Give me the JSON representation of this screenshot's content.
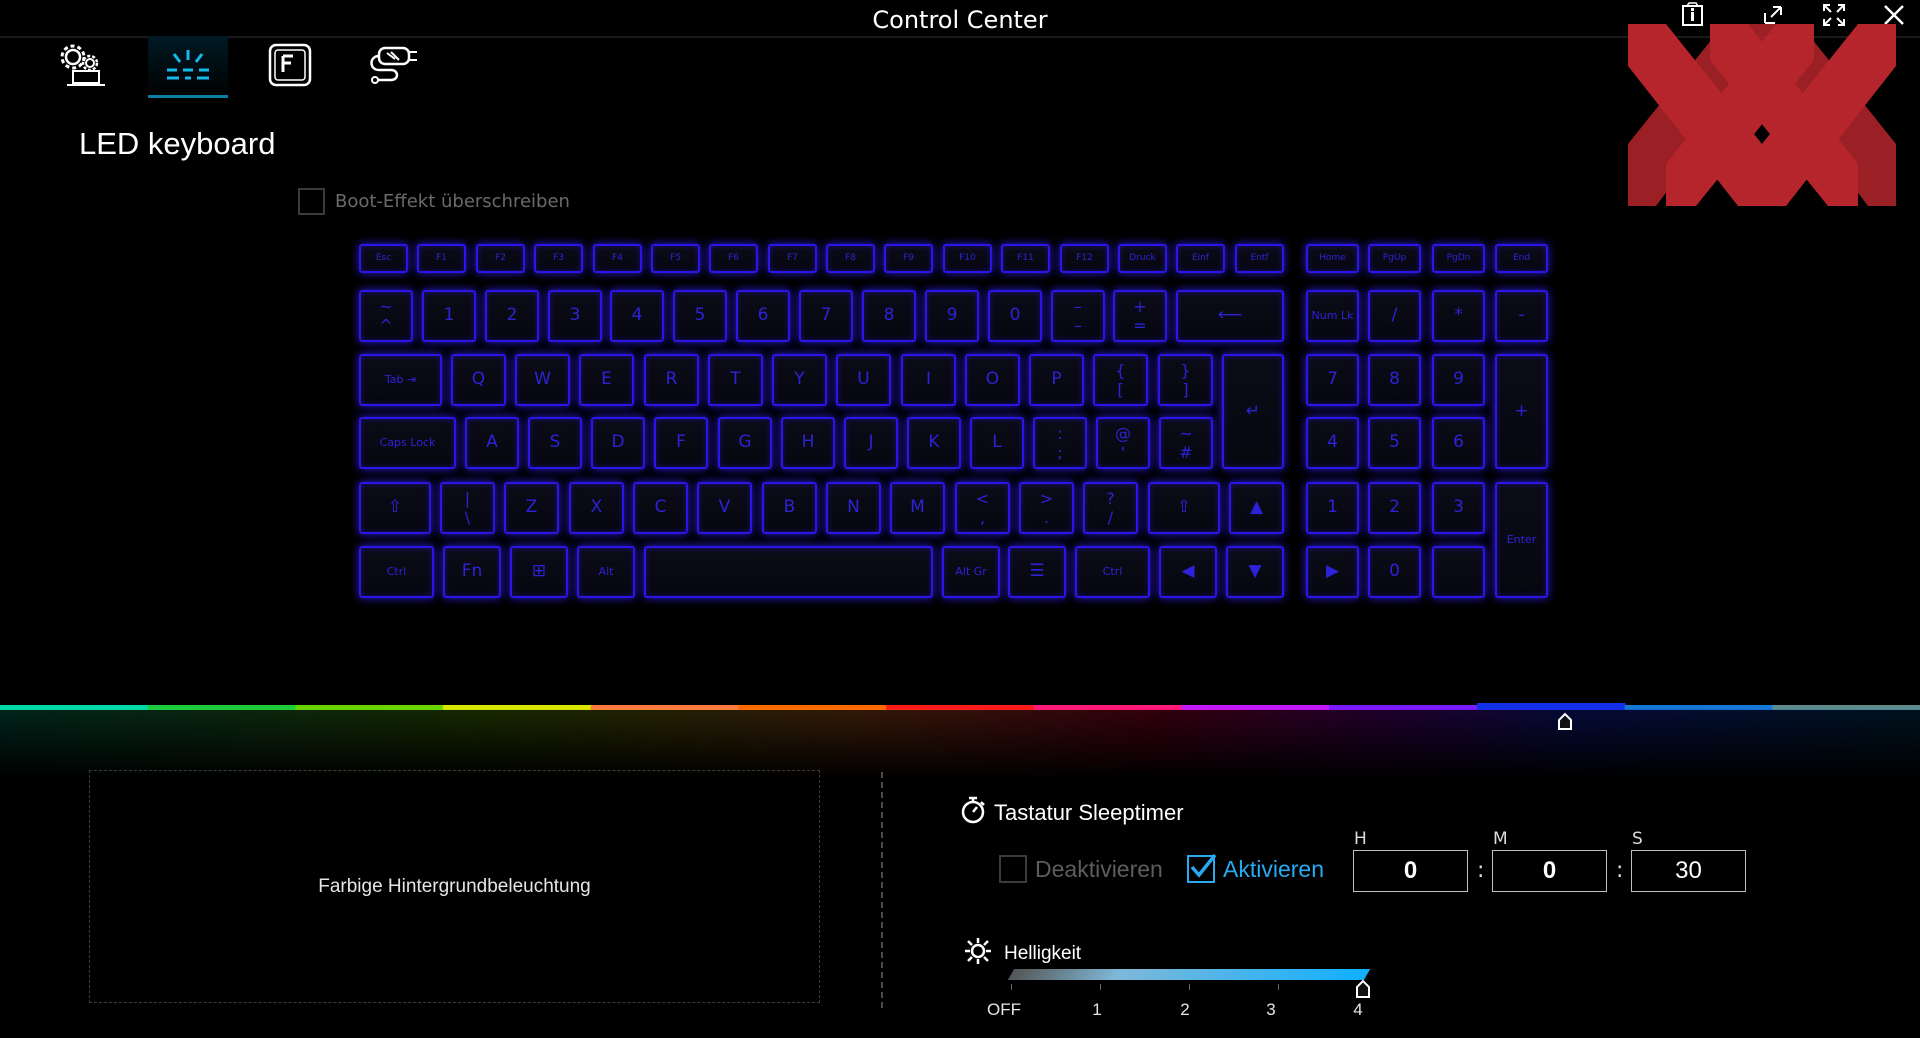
{
  "app": {
    "title": "Control Center",
    "section_title": "LED keyboard",
    "boot_effect_label": "Boot-Effekt überschreiben"
  },
  "window_buttons": [
    {
      "name": "info-icon"
    },
    {
      "name": "restore-icon"
    },
    {
      "name": "fullscreen-icon"
    },
    {
      "name": "close-icon"
    }
  ],
  "nav": [
    {
      "name": "system-settings-icon",
      "active": false
    },
    {
      "name": "led-keyboard-icon",
      "active": true
    },
    {
      "name": "function-key-icon",
      "active": false
    },
    {
      "name": "power-plug-icon",
      "active": false
    }
  ],
  "colors": {
    "key_glow": "#2a16e6",
    "accent": "#12b4e8",
    "strip": [
      "#00d9a8",
      "#1ecb3a",
      "#6ad400",
      "#d9e600",
      "#ff7a40",
      "#ff6a00",
      "#ff1a1a",
      "#ff1a7a",
      "#c21aff",
      "#7a1aff",
      "#1430e8",
      "#1478d4",
      "#5c8c8c"
    ],
    "selected_color_index": 10
  },
  "keyboard": {
    "rows": [
      [
        {
          "label": "Esc",
          "w": 1
        },
        {
          "label": "F1",
          "w": 1
        },
        {
          "label": "F2",
          "w": 1
        },
        {
          "label": "F3",
          "w": 1
        },
        {
          "label": "F4",
          "w": 1
        },
        {
          "label": "F5",
          "w": 1
        },
        {
          "label": "F6",
          "w": 1
        },
        {
          "label": "F7",
          "w": 1
        },
        {
          "label": "F8",
          "w": 1
        },
        {
          "label": "F9",
          "w": 1
        },
        {
          "label": "F10",
          "w": 1
        },
        {
          "label": "F11",
          "w": 1
        },
        {
          "label": "F12",
          "w": 1
        },
        {
          "label": "Druck",
          "w": 1
        },
        {
          "label": "Einf",
          "w": 1
        },
        {
          "label": "Entf",
          "w": 1
        }
      ],
      [
        {
          "label": "~\n^",
          "w": 1
        },
        {
          "label": "1",
          "w": 1
        },
        {
          "label": "2",
          "w": 1
        },
        {
          "label": "3",
          "w": 1
        },
        {
          "label": "4",
          "w": 1
        },
        {
          "label": "5",
          "w": 1
        },
        {
          "label": "6",
          "w": 1
        },
        {
          "label": "7",
          "w": 1
        },
        {
          "label": "8",
          "w": 1
        },
        {
          "label": "9",
          "w": 1
        },
        {
          "label": "0",
          "w": 1
        },
        {
          "label": "–\n–",
          "w": 1
        },
        {
          "label": "+\n=",
          "w": 1
        },
        {
          "label": "⟵",
          "w": 2
        }
      ],
      [
        {
          "label": "Tab ⇥",
          "w": 1.5
        },
        {
          "label": "Q",
          "w": 1
        },
        {
          "label": "W",
          "w": 1
        },
        {
          "label": "E",
          "w": 1
        },
        {
          "label": "R",
          "w": 1
        },
        {
          "label": "T",
          "w": 1
        },
        {
          "label": "Y",
          "w": 1
        },
        {
          "label": "U",
          "w": 1
        },
        {
          "label": "I",
          "w": 1
        },
        {
          "label": "O",
          "w": 1
        },
        {
          "label": "P",
          "w": 1
        },
        {
          "label": "{\n[",
          "w": 1
        },
        {
          "label": "}\n]",
          "w": 1
        }
      ],
      [
        {
          "label": "Caps Lock",
          "w": 1.8
        },
        {
          "label": "A",
          "w": 1
        },
        {
          "label": "S",
          "w": 1
        },
        {
          "label": "D",
          "w": 1
        },
        {
          "label": "F",
          "w": 1
        },
        {
          "label": "G",
          "w": 1
        },
        {
          "label": "H",
          "w": 1
        },
        {
          "label": "J",
          "w": 1
        },
        {
          "label": "K",
          "w": 1
        },
        {
          "label": "L",
          "w": 1
        },
        {
          "label": ":\n;",
          "w": 1
        },
        {
          "label": "@\n'",
          "w": 1
        },
        {
          "label": "~\n#",
          "w": 1
        }
      ],
      [
        {
          "label": "⇧",
          "w": 1.3
        },
        {
          "label": "|\n\\",
          "w": 1
        },
        {
          "label": "Z",
          "w": 1
        },
        {
          "label": "X",
          "w": 1
        },
        {
          "label": "C",
          "w": 1
        },
        {
          "label": "V",
          "w": 1
        },
        {
          "label": "B",
          "w": 1
        },
        {
          "label": "N",
          "w": 1
        },
        {
          "label": "M",
          "w": 1
        },
        {
          "label": "<\n,",
          "w": 1
        },
        {
          "label": ">\n.",
          "w": 1
        },
        {
          "label": "?\n/",
          "w": 1
        },
        {
          "label": "⇧",
          "w": 1.3
        },
        {
          "label": "▲",
          "w": 1
        }
      ],
      [
        {
          "label": "Ctrl",
          "w": 1.3
        },
        {
          "label": "Fn",
          "w": 1
        },
        {
          "label": "⊞",
          "w": 1
        },
        {
          "label": "Alt",
          "w": 1
        },
        {
          "label": "",
          "w": 5
        },
        {
          "label": "Alt Gr",
          "w": 1
        },
        {
          "label": "☰",
          "w": 1
        },
        {
          "label": "Ctrl",
          "w": 1.3
        },
        {
          "label": "◀",
          "w": 1
        },
        {
          "label": "▼",
          "w": 1
        }
      ]
    ],
    "numpad_top": [
      "Home",
      "PgUp",
      "PgDn",
      "End"
    ],
    "numpad_row1": [
      "Num Lk",
      "/",
      "*",
      "-"
    ],
    "numpad_grid": [
      [
        "7",
        "8",
        "9"
      ],
      [
        "4",
        "5",
        "6"
      ],
      [
        "1",
        "2",
        "3"
      ],
      [
        "▶",
        "0",
        ""
      ]
    ],
    "numpad_plus": "+",
    "numpad_enter": "Enter"
  },
  "background_panel": {
    "label": "Farbige Hintergrundbeleuchtung"
  },
  "sleep_timer": {
    "title": "Tastatur Sleeptimer",
    "deactivate_label": "Deaktivieren",
    "activate_label": "Aktivieren",
    "activated": true,
    "h_label": "H",
    "m_label": "M",
    "s_label": "S",
    "hours": "0",
    "minutes": "0",
    "seconds": "30",
    "separator": ":"
  },
  "brightness": {
    "title": "Helligkeit",
    "ticks": [
      "OFF",
      "1",
      "2",
      "3",
      "4"
    ],
    "level": 4,
    "max": 4
  }
}
